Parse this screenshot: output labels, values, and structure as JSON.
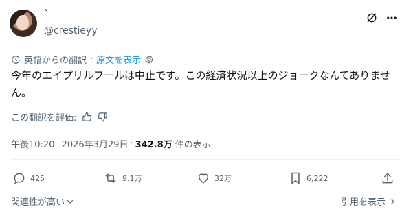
{
  "author": {
    "display_name": "`",
    "handle": "@crestieyy"
  },
  "translation": {
    "source_label": "英語からの翻訳",
    "show_original": "原文を表示"
  },
  "tweet": {
    "text": "今年のエイプリルフールは中止です。この経済状況以上のジョークなんてありません。"
  },
  "rate": {
    "label": "この翻訳を評価:"
  },
  "meta": {
    "time": "午後10:20",
    "sep1": "·",
    "date": "2026年3月29日",
    "sep2": "·",
    "views_count": "342.8万",
    "views_label": "件の表示"
  },
  "actions": {
    "replies": "425",
    "reposts": "9.1万",
    "likes": "32万",
    "bookmarks": "6,222"
  },
  "footer": {
    "relevance": "関連性が高い",
    "quotes": "引用を表示"
  },
  "colors": {
    "accent": "#1d9bf0",
    "secondary_text": "#536471",
    "primary_text": "#0f1419"
  },
  "icons": [
    "grok-icon",
    "more-icon",
    "translate-icon",
    "settings-icon",
    "thumb-up-icon",
    "thumb-down-icon",
    "reply-icon",
    "repost-icon",
    "like-icon",
    "bookmark-icon",
    "share-icon",
    "chevron-down-icon",
    "chevron-right-icon"
  ]
}
